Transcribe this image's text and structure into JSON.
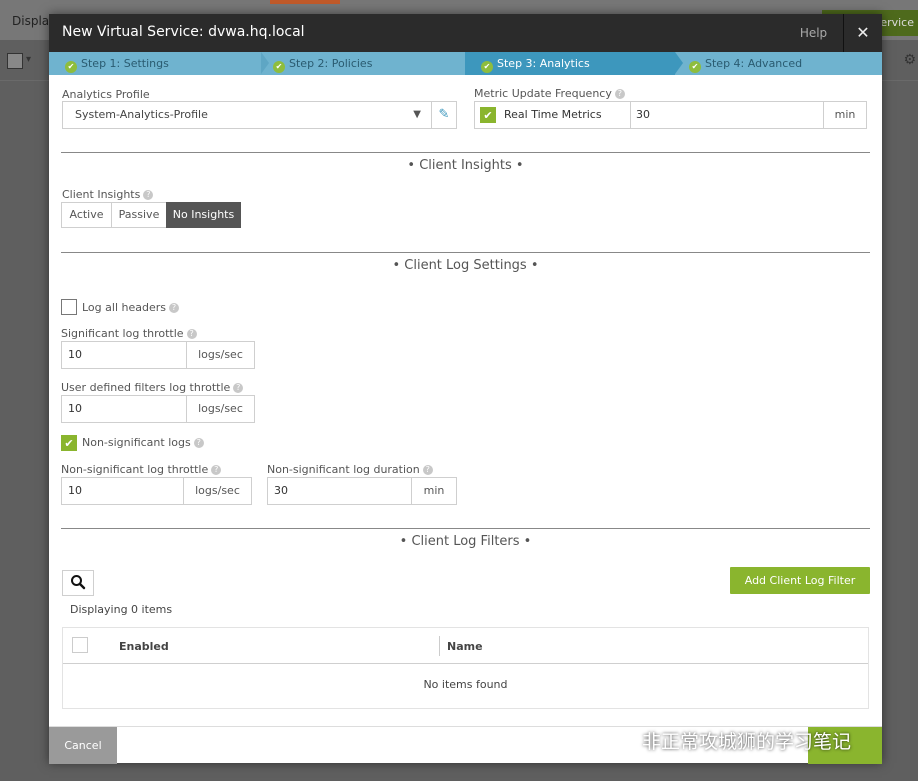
{
  "background": {
    "display_label": "Displa",
    "service_label": "ervice"
  },
  "modal": {
    "title": "New Virtual Service: dvwa.hq.local",
    "help_label": "Help",
    "close_label": "✕"
  },
  "wizard": {
    "steps": [
      {
        "label": "Step 1: Settings"
      },
      {
        "label": "Step 2: Policies"
      },
      {
        "label": "Step 3: Analytics"
      },
      {
        "label": "Step 4: Advanced"
      }
    ]
  },
  "analytics": {
    "profile_label": "Analytics Profile",
    "profile_value": "System-Analytics-Profile",
    "metric_label": "Metric Update Frequency",
    "real_time_label": "Real Time Metrics",
    "metric_value": "30",
    "metric_unit": "min"
  },
  "client_insights": {
    "section_title": "• Client Insights •",
    "label": "Client Insights",
    "options": [
      "Active",
      "Passive",
      "No Insights"
    ],
    "selected": "No Insights"
  },
  "client_log": {
    "section_title": "• Client Log Settings •",
    "log_all_headers_label": "Log all headers",
    "significant_throttle_label": "Significant log throttle",
    "significant_throttle_value": "10",
    "significant_throttle_unit": "logs/sec",
    "udf_throttle_label": "User defined filters log throttle",
    "udf_throttle_value": "10",
    "udf_throttle_unit": "logs/sec",
    "non_significant_label": "Non-significant logs",
    "ns_throttle_label": "Non-significant log throttle",
    "ns_throttle_value": "10",
    "ns_throttle_unit": "logs/sec",
    "ns_duration_label": "Non-significant log duration",
    "ns_duration_value": "30",
    "ns_duration_unit": "min"
  },
  "client_filters": {
    "section_title": "• Client Log Filters •",
    "add_button": "Add Client Log Filter",
    "displaying": "Displaying 0 items",
    "columns": [
      "Enabled",
      "Name"
    ],
    "empty_text": "No items found"
  },
  "footer": {
    "cancel_label": "Cancel"
  },
  "watermark": {
    "text": "非正常攻城狮的学习笔记"
  },
  "colors": {
    "accent_green": "#8ab52e",
    "wizard_blue": "#6fb3cf",
    "wizard_active": "#3d97bd",
    "header_dark": "#2b2b2b"
  }
}
